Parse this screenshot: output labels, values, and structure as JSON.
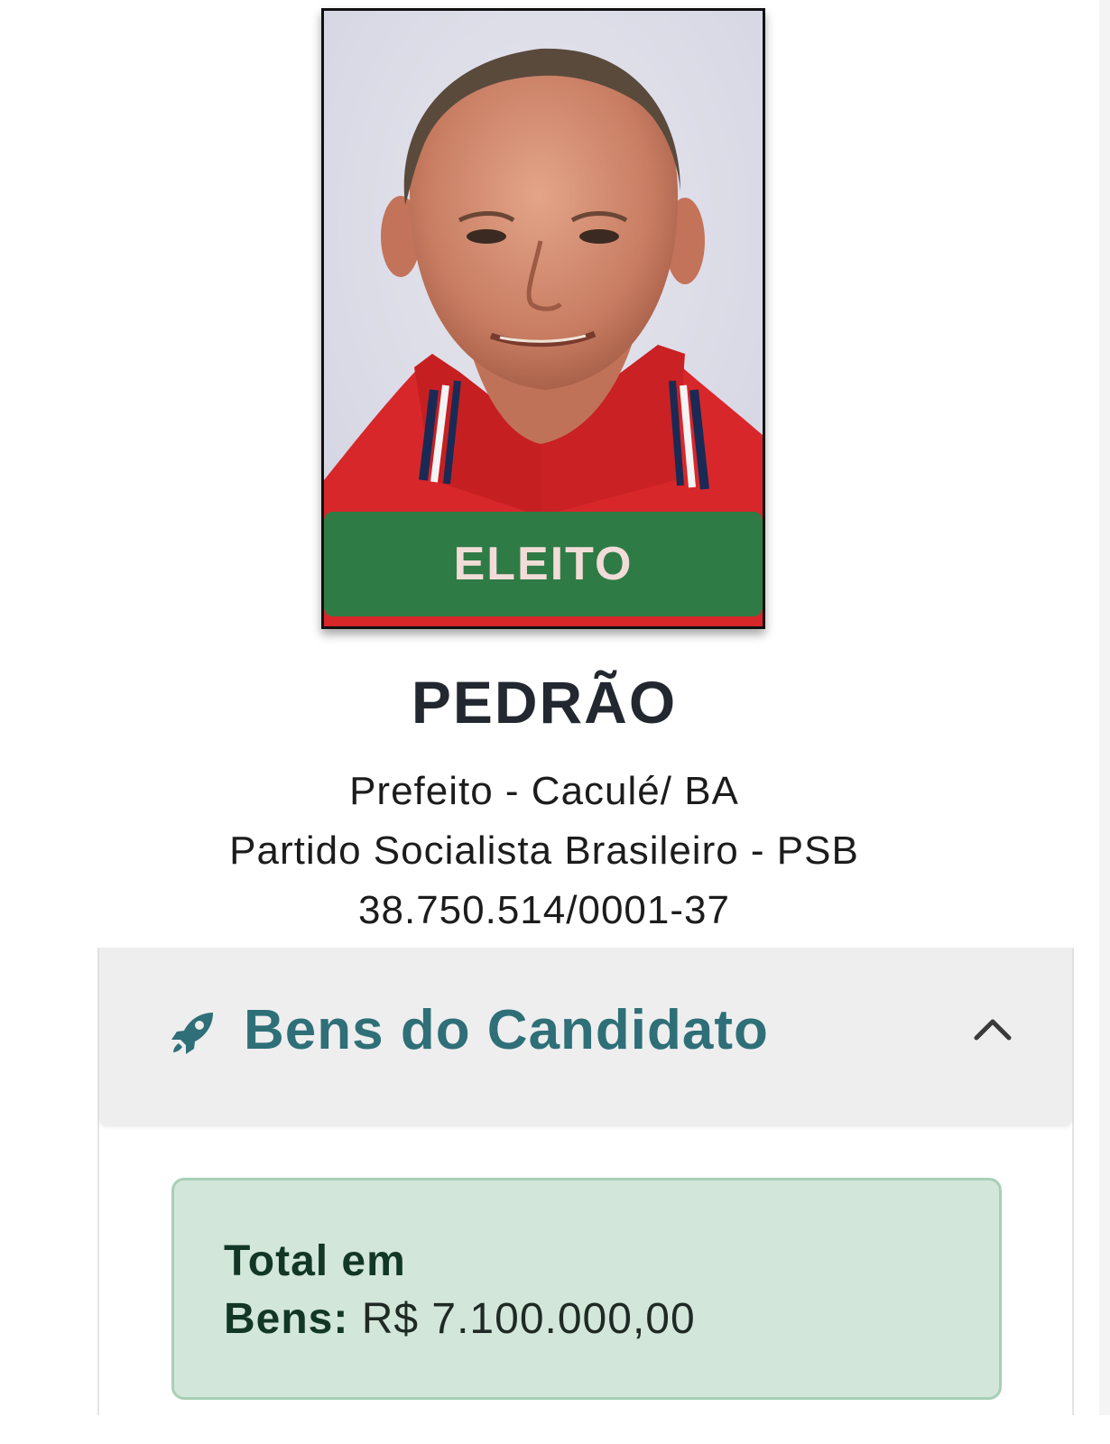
{
  "candidate": {
    "status_label": "ELEITO",
    "name": "PEDRÃO",
    "role_location": "Prefeito - Caculé/ BA",
    "party": "Partido Socialista Brasileiro - PSB",
    "cnpj": "38.750.514/0001-37"
  },
  "assets_section": {
    "title": "Bens do Candidato",
    "icon": "rocket-icon",
    "toggle_icon": "chevron-up-icon",
    "total_label_line1": "Total em",
    "total_label_line2": "Bens:",
    "total_value": "R$ 7.100.000,00"
  },
  "colors": {
    "elected_banner": "#2f7b45",
    "section_title": "#2e6f78",
    "total_box_bg": "#d2e7da",
    "total_box_border": "#a8cfb6"
  }
}
